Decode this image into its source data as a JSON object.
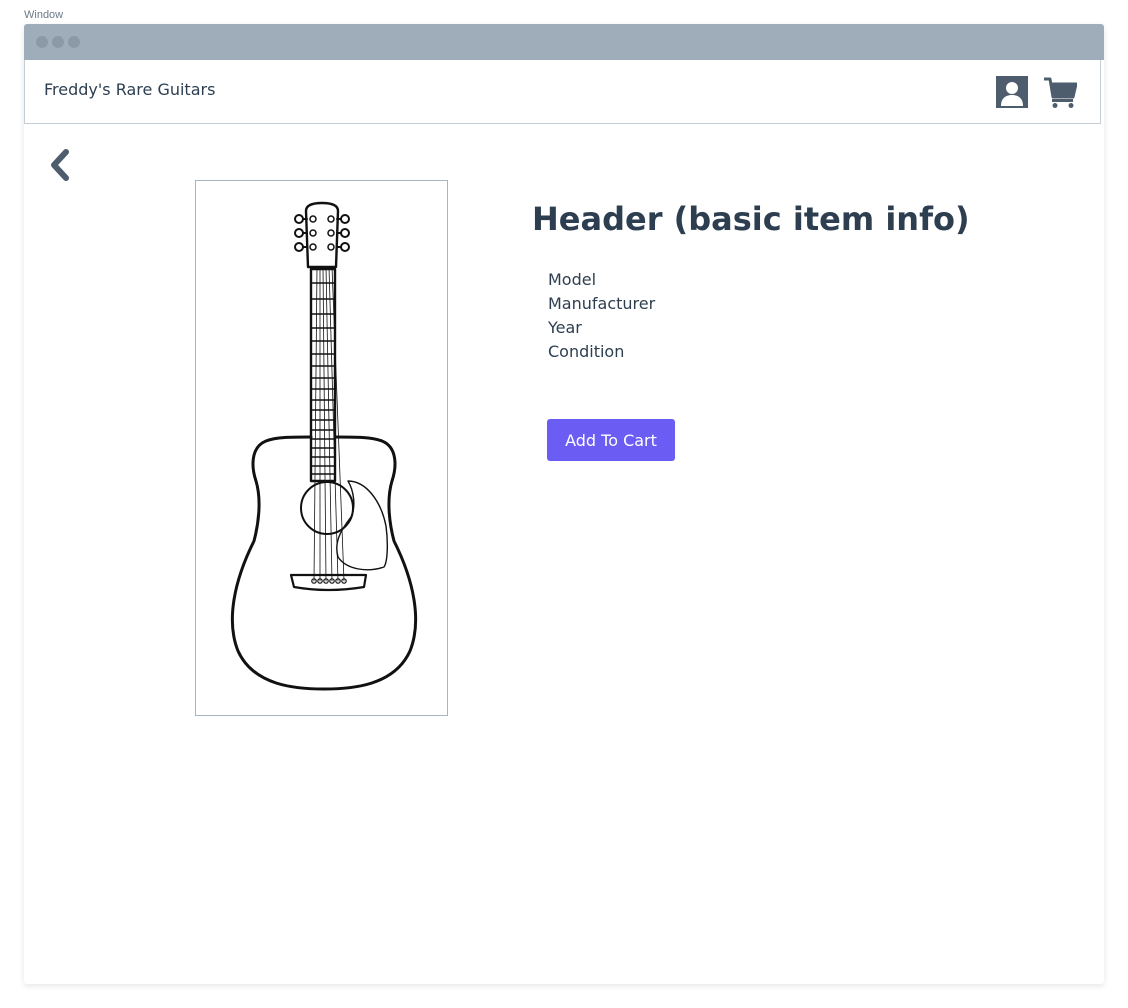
{
  "window": {
    "caption": "Window"
  },
  "navbar": {
    "brand": "Freddy's Rare Guitars",
    "account_icon": "user-icon",
    "cart_icon": "shopping-cart-icon"
  },
  "navigation": {
    "back_icon": "chevron-left-icon"
  },
  "product": {
    "image_icon": "acoustic-guitar-image",
    "header": "Header (basic item info)",
    "details": [
      "Model",
      "Manufacturer",
      "Year",
      "Condition"
    ],
    "add_to_cart_label": "Add To Cart"
  },
  "colors": {
    "titlebar": "#9fadba",
    "text": "#2c3e50",
    "accent": "#6b5cf4",
    "icon": "#4d5d6e"
  }
}
